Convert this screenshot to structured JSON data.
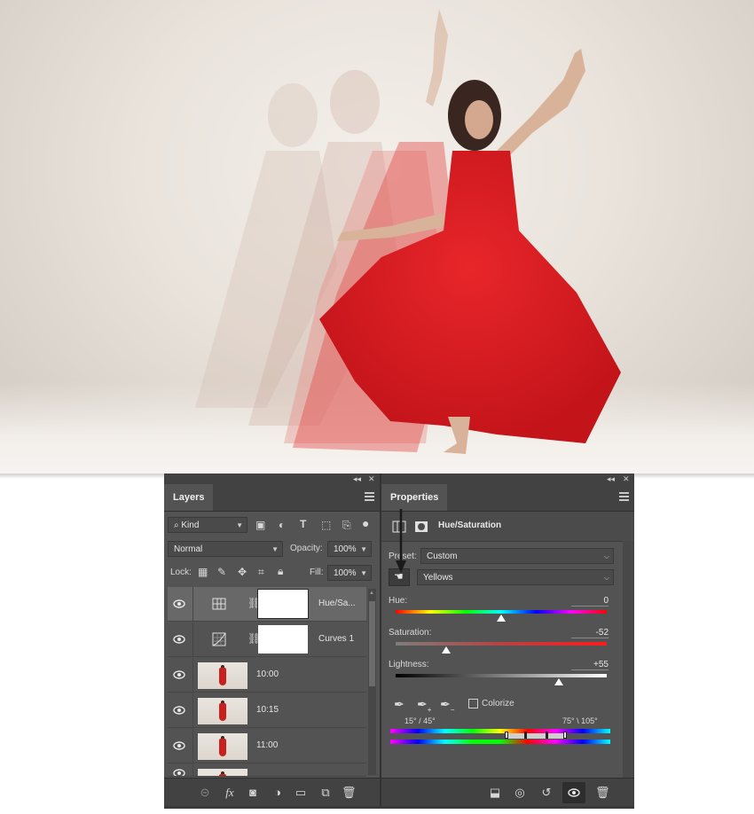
{
  "layers_panel": {
    "title": "Layers",
    "filter_kind": "Kind",
    "blend_mode": "Normal",
    "opacity_label": "Opacity:",
    "opacity_value": "100%",
    "lock_label": "Lock:",
    "fill_label": "Fill:",
    "fill_value": "100%",
    "layers": [
      {
        "name": "Hue/Sa...",
        "type": "adjustment",
        "icon": "hue-saturation-icon",
        "selected": true
      },
      {
        "name": "Curves 1",
        "type": "adjustment",
        "icon": "curves-icon",
        "selected": false
      },
      {
        "name": "10:00",
        "type": "photo",
        "selected": false
      },
      {
        "name": "10:15",
        "type": "photo",
        "selected": false
      },
      {
        "name": "11:00",
        "type": "photo",
        "selected": false
      }
    ],
    "footer_icons": [
      "link-icon",
      "fx-icon",
      "add-mask-icon",
      "new-adjustment-icon",
      "folder-icon",
      "new-layer-icon",
      "trash-icon"
    ]
  },
  "properties_panel": {
    "title": "Properties",
    "adjustment_name": "Hue/Saturation",
    "preset_label": "Preset:",
    "preset_value": "Custom",
    "channel_value": "Yellows",
    "hue_label": "Hue:",
    "hue_value": "0",
    "hue_level": 0,
    "saturation_label": "Saturation:",
    "saturation_value": "-52",
    "saturation_level": -52,
    "lightness_label": "Lightness:",
    "lightness_value": "+55",
    "lightness_level": 55,
    "colorize_label": "Colorize",
    "colorize_checked": false,
    "range_left": "15° / 45°",
    "range_right": "75° \\ 105°",
    "footer_icons": [
      "clip-to-layer-icon",
      "view-previous-icon",
      "reset-icon",
      "visibility-icon",
      "trash-icon"
    ]
  },
  "colors": {
    "panel_bg": "#535353",
    "panel_dark": "#424242",
    "selected_row": "#686868",
    "dress_red": "#d81e1e"
  }
}
